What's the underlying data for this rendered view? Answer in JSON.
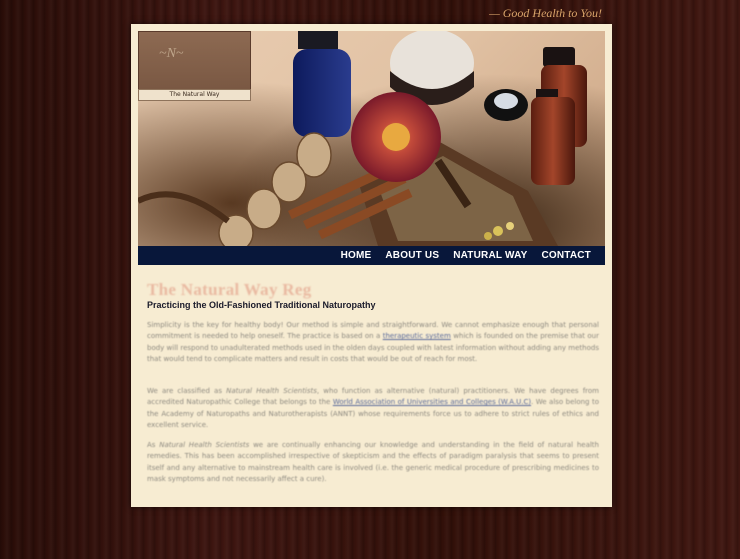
{
  "tagline": "— Good Health to You!",
  "logo": {
    "caption": "The Natural Way"
  },
  "hero": {
    "image": "natural-remedies-photo"
  },
  "nav": [
    "HOME",
    "ABOUT US",
    "NATURAL WAY",
    "CONTACT"
  ],
  "page_title": "The Natural Way Reg",
  "subtitle": "Practicing the Old-Fashioned Traditional Naturopathy",
  "paragraphs": {
    "p1_before": "Simplicity is the key for healthy body! Our method is simple and straightforward. We cannot emphasize enough that personal commitment is needed to help oneself. The practice is based on a",
    "p1_link": "therapeutic system",
    "p1_after": "which is founded on the premise that our body will respond to unadulterated methods used in the olden days coupled with latest information without adding any methods that would tend to complicate matters and result in costs that would be out of reach for most.",
    "p2_before": "We are classified as",
    "p2_italic": "Natural Health Scientists",
    "p2_mid": ", who function as alternative (natural) practitioners. We have degrees from accredited Naturopathic College that belongs to the",
    "p2_link": "World Association of Universities and Colleges (W.A.U.C)",
    "p2_after": ". We also belong to the Academy of Naturopaths and Naturotherapists (ANNT) whose requirements force us to adhere to strict rules of ethics and excellent service.",
    "p3_before": "As",
    "p3_italic": "Natural Health Scientists",
    "p3_after": "we are continually enhancing our knowledge and understanding in the field of natural health remedies. This has been accomplished irrespective of skepticism and the effects of paradigm paralysis that seems to present itself and any alternative to mainstream health care is involved (i.e. the generic medical procedure of prescribing medicines to mask symptoms and not necessarily affect a cure)."
  }
}
